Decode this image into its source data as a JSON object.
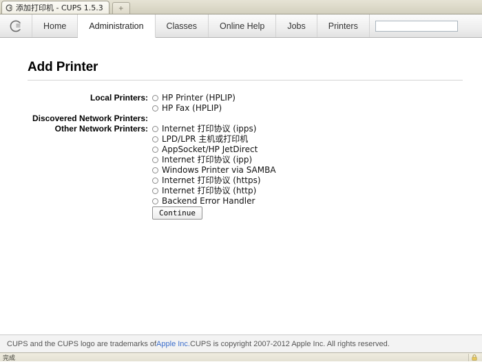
{
  "browser": {
    "tab": {
      "title": "添加打印机 - CUPS 1.5.3",
      "favicon_icon": "cups-favicon-icon"
    },
    "new_tab_label": "+",
    "statusbar": {
      "text": "完成",
      "lock_icon": "lock-icon"
    }
  },
  "nav": {
    "logo_icon": "cups-logo-icon",
    "tabs": [
      {
        "label": "Home",
        "active": false
      },
      {
        "label": "Administration",
        "active": true
      },
      {
        "label": "Classes",
        "active": false
      },
      {
        "label": "Online Help",
        "active": false
      },
      {
        "label": "Jobs",
        "active": false
      },
      {
        "label": "Printers",
        "active": false
      }
    ],
    "search": {
      "value": "",
      "placeholder": ""
    }
  },
  "main": {
    "title": "Add Printer",
    "groups": [
      {
        "label": "Local Printers:",
        "options": [
          "HP Printer (HPLIP)",
          "HP Fax (HPLIP)"
        ]
      },
      {
        "label": "Discovered Network Printers:",
        "options": []
      },
      {
        "label": "Other Network Printers:",
        "options": [
          "Internet 打印协议 (ipps)",
          "LPD/LPR 主机或打印机",
          "AppSocket/HP JetDirect",
          "Internet 打印协议 (ipp)",
          "Windows Printer via SAMBA",
          "Internet 打印协议 (https)",
          "Internet 打印协议 (http)",
          "Backend Error Handler"
        ]
      }
    ],
    "continue_label": "Continue"
  },
  "footer": {
    "text_before": "CUPS and the CUPS logo are trademarks of ",
    "link_text": "Apple Inc.",
    "text_after": " CUPS is copyright 2007-2012 Apple Inc. All rights reserved."
  }
}
